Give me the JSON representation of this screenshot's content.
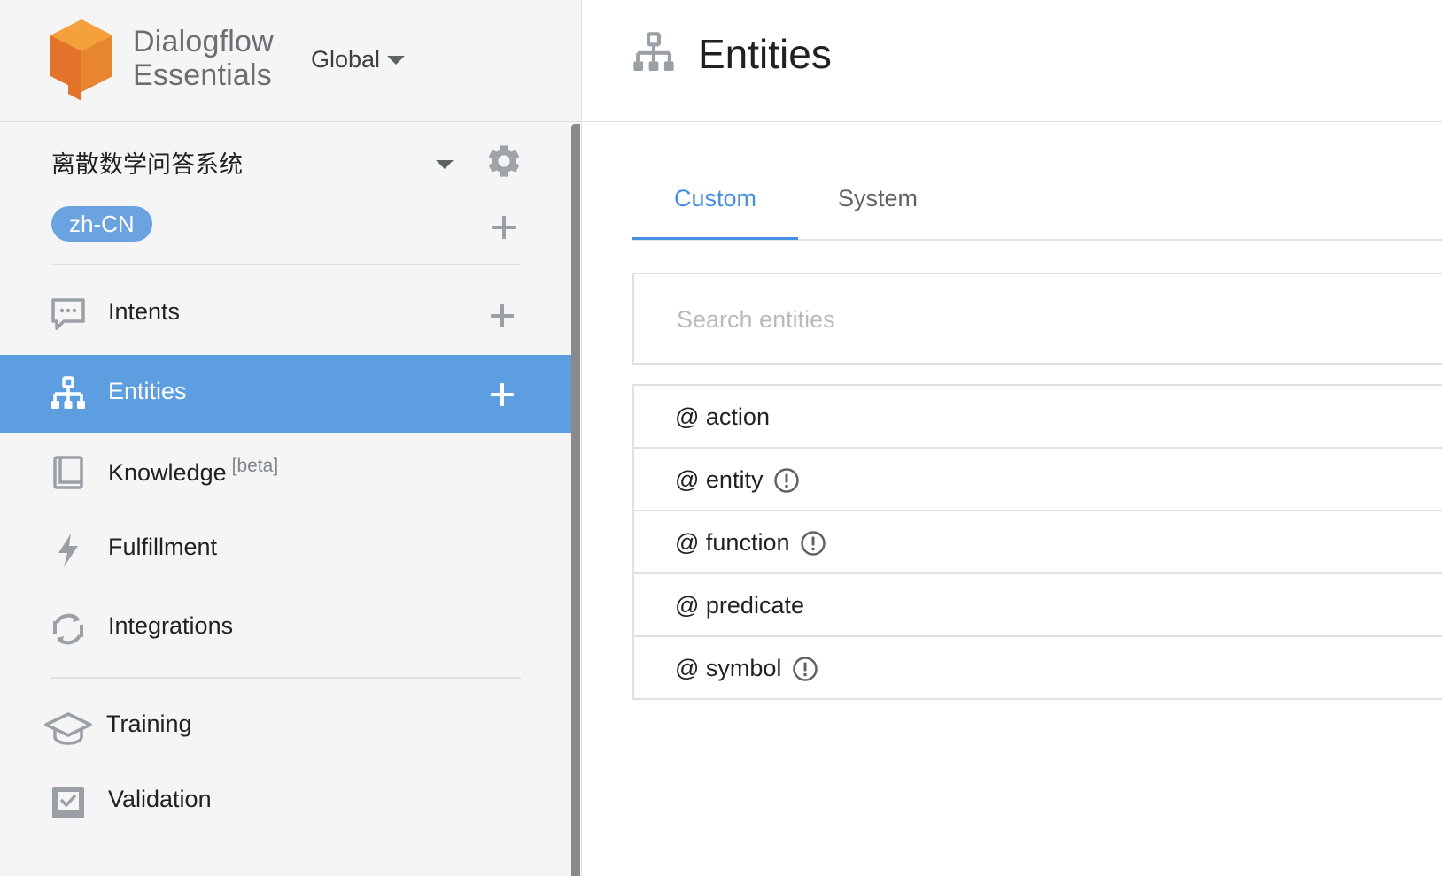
{
  "brand": {
    "line1": "Dialogflow",
    "line2": "Essentials",
    "logo_icon": "dialogflow-cube-logo",
    "logo_colors": [
      "#f4a03b",
      "#e3722b",
      "#f7b347"
    ]
  },
  "region": {
    "label": "Global"
  },
  "agent": {
    "name": "离散数学问答系统",
    "language": "zh-CN"
  },
  "nav": {
    "items": [
      {
        "label": "Intents",
        "icon": "chat-bubble-icon",
        "has_add": true
      },
      {
        "label": "Entities",
        "icon": "sitemap-icon",
        "has_add": true,
        "active": true
      },
      {
        "label": "Knowledge",
        "suffix": "[beta]",
        "icon": "book-icon"
      },
      {
        "label": "Fulfillment",
        "icon": "lightning-icon"
      },
      {
        "label": "Integrations",
        "icon": "sync-icon"
      },
      {
        "label": "Training",
        "icon": "graduation-cap-icon"
      },
      {
        "label": "Validation",
        "icon": "checkbox-icon"
      }
    ]
  },
  "main": {
    "title": "Entities",
    "title_icon": "sitemap-icon",
    "tabs": [
      {
        "label": "Custom",
        "active": true
      },
      {
        "label": "System"
      }
    ],
    "search": {
      "placeholder": "Search entities",
      "value": ""
    },
    "entities": [
      {
        "name": "@ action",
        "warning": false
      },
      {
        "name": "@ entity",
        "warning": true
      },
      {
        "name": "@ function",
        "warning": true
      },
      {
        "name": "@ predicate",
        "warning": false
      },
      {
        "name": "@ symbol",
        "warning": true
      }
    ]
  },
  "colors": {
    "accent": "#4a90e2",
    "active_nav_bg": "#5c9edf",
    "badge_bg": "#6aa3e0",
    "sidebar_bg": "#f5f5f5"
  }
}
